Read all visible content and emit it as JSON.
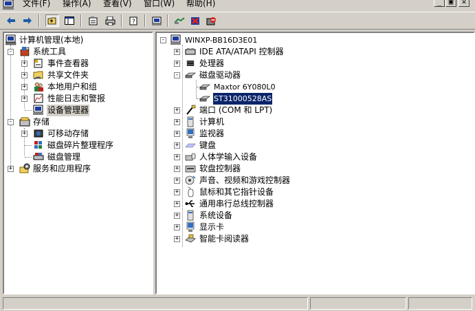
{
  "menu": {
    "items": [
      {
        "label": "文件(F)",
        "icon": "computer-management-icon"
      },
      {
        "label": "操作(A)"
      },
      {
        "label": "查看(V)"
      },
      {
        "label": "窗口(W)"
      },
      {
        "label": "帮助(H)"
      }
    ],
    "window_buttons": [
      "_",
      "▣",
      "✕"
    ]
  },
  "toolbar": {
    "buttons": [
      "back-icon",
      "forward-icon",
      "up-folder-icon",
      "show-hide-tree-icon",
      "properties-icon",
      "print-icon",
      "help-icon",
      "refresh-icon",
      "scan-hardware-icon",
      "disable-device-icon",
      "uninstall-device-icon"
    ]
  },
  "left_tree": {
    "items": [
      {
        "label": "计算机管理(本地)",
        "icon": "computer-management-icon",
        "expander": ""
      },
      {
        "label": "系统工具",
        "icon": "system-tools-icon",
        "expander": "-"
      },
      {
        "label": "事件查看器",
        "icon": "event-viewer-icon",
        "expander": "+"
      },
      {
        "label": "共享文件夹",
        "icon": "shared-folder-icon",
        "expander": "+"
      },
      {
        "label": "本地用户和组",
        "icon": "users-groups-icon",
        "expander": "+"
      },
      {
        "label": "性能日志和警报",
        "icon": "performance-logs-icon",
        "expander": "+"
      },
      {
        "label": "设备管理器",
        "icon": "device-manager-icon",
        "expander": ""
      },
      {
        "label": "存储",
        "icon": "storage-icon",
        "expander": "-"
      },
      {
        "label": "可移动存储",
        "icon": "removable-storage-icon",
        "expander": "+"
      },
      {
        "label": "磁盘碎片整理程序",
        "icon": "defragmenter-icon",
        "expander": ""
      },
      {
        "label": "磁盘管理",
        "icon": "disk-management-icon",
        "expander": ""
      },
      {
        "label": "服务和应用程序",
        "icon": "services-apps-icon",
        "expander": "+"
      }
    ]
  },
  "right_tree": {
    "root": {
      "label": "WINXP-BB16D3E01",
      "icon": "computer-icon",
      "expander": "-"
    },
    "items": [
      {
        "label": "IDE ATA/ATAPI 控制器",
        "icon": "ide-controller-icon",
        "expander": "+"
      },
      {
        "label": "处理器",
        "icon": "processor-icon",
        "expander": "+"
      },
      {
        "label": "磁盘驱动器",
        "icon": "disk-drive-icon",
        "expander": "-"
      },
      {
        "label": "Maxtor 6Y080L0",
        "icon": "hard-disk-icon",
        "expander": ""
      },
      {
        "label": "ST31000528AS",
        "icon": "hard-disk-icon",
        "expander": "",
        "selected": true
      },
      {
        "label": "端口 (COM 和 LPT)",
        "icon": "port-icon",
        "expander": "+"
      },
      {
        "label": "计算机",
        "icon": "computer-icon",
        "expander": "+"
      },
      {
        "label": "监视器",
        "icon": "monitor-icon",
        "expander": "+"
      },
      {
        "label": "键盘",
        "icon": "keyboard-icon",
        "expander": "+"
      },
      {
        "label": "人体学输入设备",
        "icon": "hid-icon",
        "expander": "+"
      },
      {
        "label": "软盘控制器",
        "icon": "floppy-controller-icon",
        "expander": "+"
      },
      {
        "label": "声音、视频和游戏控制器",
        "icon": "sound-icon",
        "expander": "+"
      },
      {
        "label": "鼠标和其它指针设备",
        "icon": "mouse-icon",
        "expander": "+"
      },
      {
        "label": "通用串行总线控制器",
        "icon": "usb-icon",
        "expander": "+"
      },
      {
        "label": "系统设备",
        "icon": "system-device-icon",
        "expander": "+"
      },
      {
        "label": "显示卡",
        "icon": "display-adapter-icon",
        "expander": "+"
      },
      {
        "label": "智能卡阅读器",
        "icon": "smart-card-reader-icon",
        "expander": "+"
      }
    ]
  },
  "colors": {
    "selection": "#0a246a",
    "chrome": "#d4d0c8"
  }
}
